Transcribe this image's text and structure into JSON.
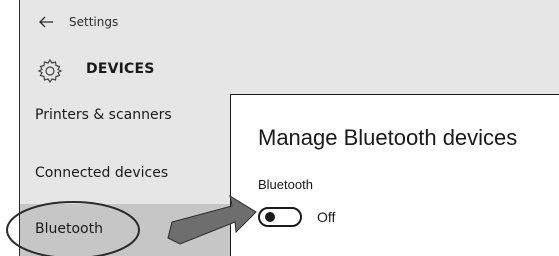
{
  "window": {
    "app_title": "Settings",
    "section_title": "DEVICES"
  },
  "sidebar": {
    "items": [
      {
        "label": "Printers & scanners"
      },
      {
        "label": "Connected devices"
      },
      {
        "label": "Bluetooth",
        "selected": true
      }
    ]
  },
  "content": {
    "page_title": "Manage Bluetooth devices",
    "bluetooth_label": "Bluetooth",
    "toggle_state": "Off",
    "toggle_on": false
  },
  "icons": {
    "back": "back-arrow-icon",
    "section": "gear-icon"
  },
  "colors": {
    "window_bg": "#e6e6e6",
    "selected_bg": "#c6c6c6",
    "content_bg": "#ffffff",
    "annotation_arrow": "#6e6e6e"
  }
}
